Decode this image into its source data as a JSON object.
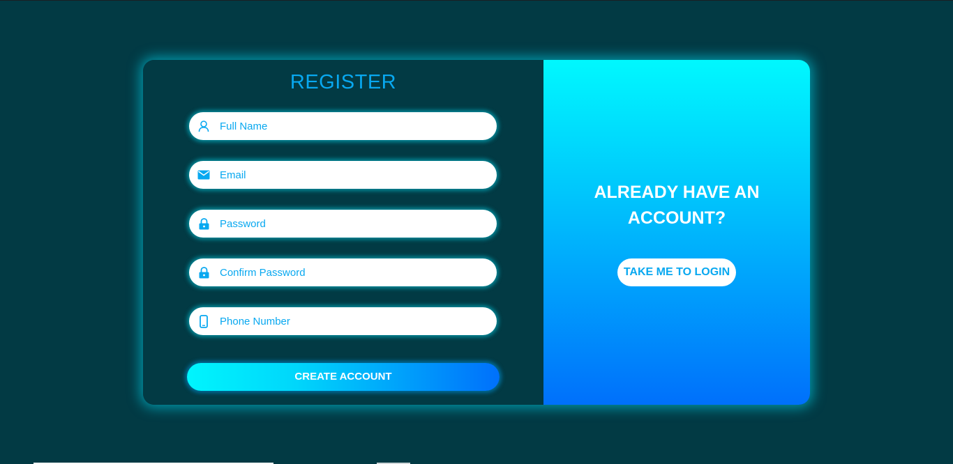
{
  "colors": {
    "background": "#023a44",
    "accent": "#08a8f0",
    "glow": "#00e6ff",
    "gradient_start": "#00f8fe",
    "gradient_end": "#0070fb"
  },
  "register": {
    "title": "REGISTER",
    "fields": [
      {
        "icon": "user-icon",
        "placeholder": "Full Name"
      },
      {
        "icon": "mail-icon",
        "placeholder": "Email"
      },
      {
        "icon": "lock-icon",
        "placeholder": "Password"
      },
      {
        "icon": "lock-icon",
        "placeholder": "Confirm Password"
      },
      {
        "icon": "phone-icon",
        "placeholder": "Phone Number"
      }
    ],
    "submit_label": "CREATE ACCOUNT"
  },
  "login_prompt": {
    "line1": "ALREADY HAVE AN",
    "line2": "ACCOUNT?",
    "button_label": "TAKE ME TO LOGIN"
  }
}
